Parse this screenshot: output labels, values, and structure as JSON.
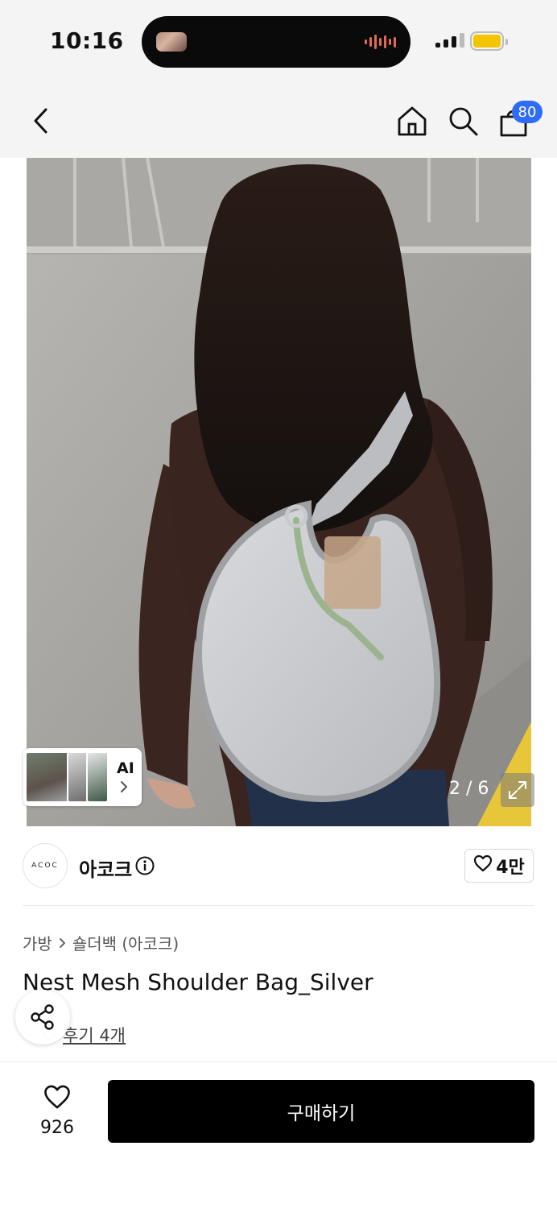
{
  "status_bar": {
    "time": "10:16"
  },
  "header": {
    "cart_count": "80"
  },
  "gallery": {
    "page_counter": "2 / 6",
    "ai_label": "AI"
  },
  "brand": {
    "logo_text": "ACOC",
    "name": "아코크",
    "like_count": "4만"
  },
  "product": {
    "breadcrumb": [
      "가방",
      "숄더백 (아코크)"
    ],
    "title": "Nest Mesh Shoulder Bag_Silver",
    "review_text": "후기 4개"
  },
  "bottom_bar": {
    "wish_count": "926",
    "buy_label": "구매하기"
  },
  "colors": {
    "badge": "#2f6cf6",
    "buy_button": "#000000",
    "battery": "#f5c400"
  },
  "icons": [
    "back-icon",
    "home-icon",
    "search-icon",
    "cart-icon",
    "info-icon",
    "heart-icon",
    "share-icon",
    "expand-icon",
    "chevron-right-icon"
  ]
}
